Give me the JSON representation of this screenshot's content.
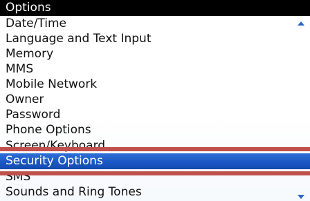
{
  "header": {
    "title": "Options"
  },
  "options_list": {
    "items": [
      {
        "label": "Date/Time"
      },
      {
        "label": "Language and Text Input"
      },
      {
        "label": "Memory"
      },
      {
        "label": "MMS"
      },
      {
        "label": "Mobile Network"
      },
      {
        "label": "Owner"
      },
      {
        "label": "Password"
      },
      {
        "label": "Phone Options"
      },
      {
        "label": "Screen/Keyboard"
      },
      {
        "label": "Security Options",
        "selected": true
      },
      {
        "label": "SMS"
      },
      {
        "label": "Sounds and Ring Tones"
      }
    ],
    "selected_index": 9
  },
  "colors": {
    "title_bg": "#000000",
    "selection_bg": "#1a56c4",
    "highlight_band": "#c0504d",
    "scroll_arrow": "#2a67c9"
  },
  "icons": {
    "scroll_up": "scroll-up-arrow-icon",
    "scroll_down": "scroll-down-arrow-icon"
  }
}
